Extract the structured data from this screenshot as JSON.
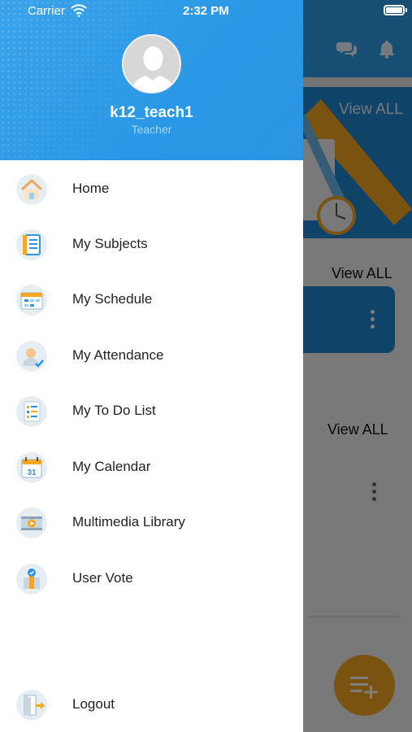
{
  "status_bar": {
    "carrier": "Carrier",
    "time": "2:32 PM"
  },
  "background": {
    "view_all_1": "View ALL",
    "view_all_2": "View ALL",
    "view_all_3": "View ALL"
  },
  "drawer": {
    "user": {
      "name": "k12_teach1",
      "role": "Teacher"
    },
    "menu": [
      {
        "label": "Home",
        "icon": "home-icon"
      },
      {
        "label": "My Subjects",
        "icon": "subjects-notebook-icon"
      },
      {
        "label": "My Schedule",
        "icon": "schedule-calendar-icon"
      },
      {
        "label": "My Attendance",
        "icon": "attendance-person-icon"
      },
      {
        "label": "My To Do List",
        "icon": "todo-list-icon"
      },
      {
        "label": "My Calendar",
        "icon": "calendar-icon"
      },
      {
        "label": "Multimedia Library",
        "icon": "multimedia-film-icon"
      },
      {
        "label": "User Vote",
        "icon": "user-vote-icon"
      }
    ],
    "logout": {
      "label": "Logout",
      "icon": "logout-door-icon"
    },
    "calendar_icon_day": "31"
  },
  "colors": {
    "primary_blue": "#2c9ce8",
    "fab_orange": "#f5a623",
    "drawer_bg": "#ffffff"
  }
}
